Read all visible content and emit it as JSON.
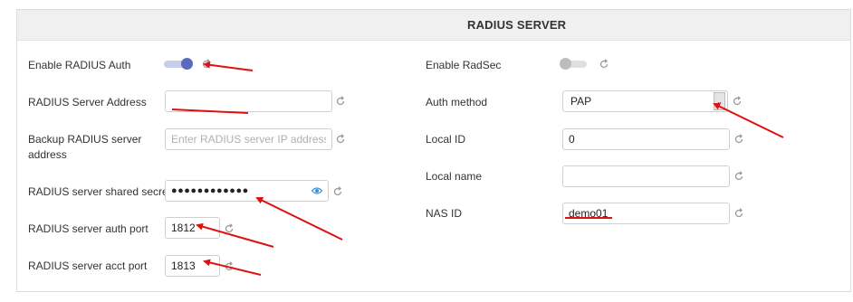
{
  "panel": {
    "title": "RADIUS SERVER"
  },
  "left": {
    "enable_auth": {
      "label": "Enable RADIUS Auth",
      "on": true
    },
    "server_address": {
      "label": "RADIUS Server Address",
      "value": ""
    },
    "backup_server": {
      "label_line1": "Backup RADIUS server",
      "label_line2": "address",
      "placeholder": "Enter RADIUS server IP address",
      "value": ""
    },
    "shared_secret": {
      "label": "RADIUS server shared secret",
      "value": "●●●●●●●●●●●●"
    },
    "auth_port": {
      "label": "RADIUS server auth port",
      "value": "1812"
    },
    "acct_port": {
      "label": "RADIUS server acct port",
      "value": "1813"
    }
  },
  "right": {
    "enable_radsec": {
      "label": "Enable RadSec",
      "on": false
    },
    "auth_method": {
      "label": "Auth method",
      "value": "PAP"
    },
    "local_id": {
      "label": "Local ID",
      "value": "0"
    },
    "local_name": {
      "label": "Local name",
      "value": ""
    },
    "nas_id": {
      "label": "NAS ID",
      "value": "demo01"
    }
  },
  "colors": {
    "toggle_on": "#5a6bbd",
    "toggle_on_track": "#c7cdeb",
    "toggle_off": "#bdbdbd",
    "annotation": "#e01010",
    "eye": "#3a8fd6"
  },
  "icons": {
    "reset": "reset-icon",
    "eye": "eye-icon",
    "dropdown": "chevron-down-icon"
  }
}
